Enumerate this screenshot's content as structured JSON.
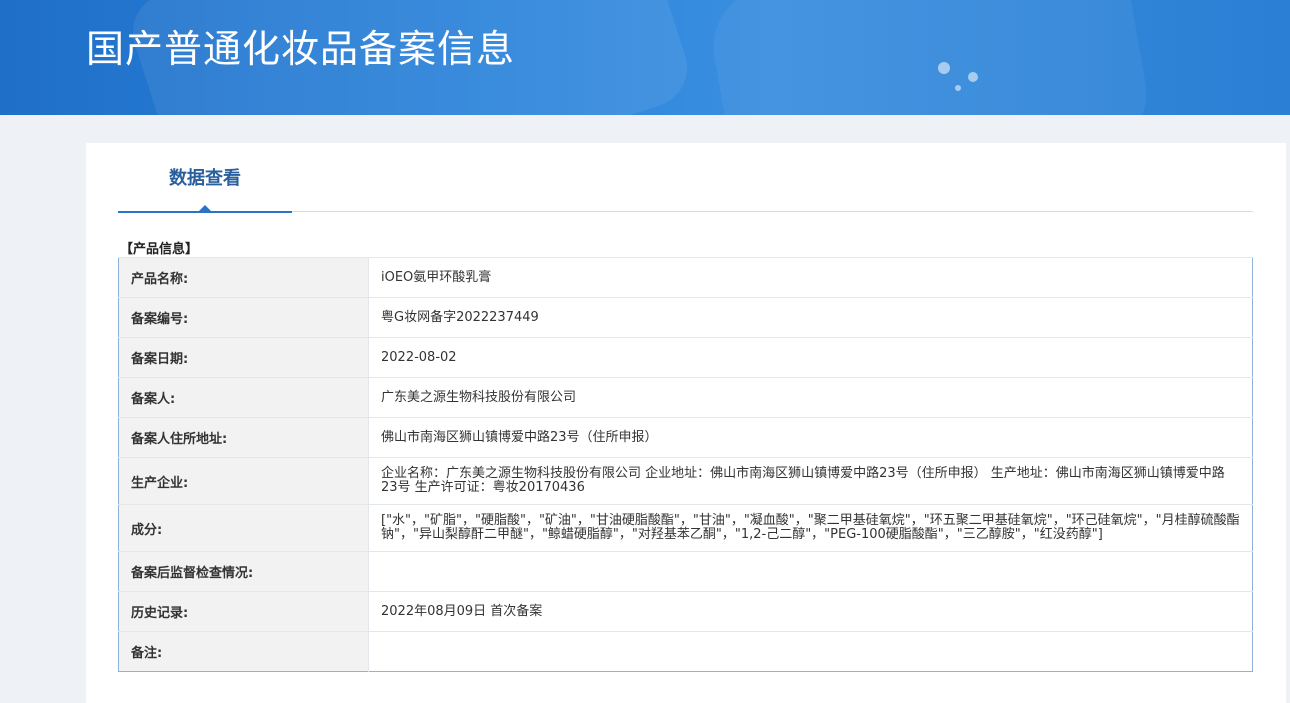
{
  "banner": {
    "title": "国产普通化妆品备案信息"
  },
  "tabs": [
    {
      "label": "数据查看"
    }
  ],
  "section": {
    "title": "【产品信息】"
  },
  "rows": [
    {
      "label": "产品名称:",
      "value": "iOEO氨甲环酸乳膏"
    },
    {
      "label": "备案编号:",
      "value": "粤G妆网备字2022237449"
    },
    {
      "label": "备案日期:",
      "value": "2022-08-02"
    },
    {
      "label": "备案人:",
      "value": "广东美之源生物科技股份有限公司"
    },
    {
      "label": "备案人住所地址:",
      "value": "佛山市南海区狮山镇博爱中路23号（住所申报）"
    },
    {
      "label": "生产企业:",
      "value": "企业名称：广东美之源生物科技股份有限公司 企业地址：佛山市南海区狮山镇博爱中路23号（住所申报） 生产地址：佛山市南海区狮山镇博爱中路23号 生产许可证：粤妆20170436"
    },
    {
      "label": "成分:",
      "value": "[\"水\"，\"矿脂\"，\"硬脂酸\"，\"矿油\"，\"甘油硬脂酸酯\"，\"甘油\"，\"凝血酸\"，\"聚二甲基硅氧烷\"，\"环五聚二甲基硅氧烷\"，\"环己硅氧烷\"，\"月桂醇硫酸酯钠\"，\"异山梨醇酐二甲醚\"，\"鲸蜡硬脂醇\"，\"对羟基苯乙酮\"，\"1,2-己二醇\"，\"PEG-100硬脂酸酯\"，\"三乙醇胺\"，\"红没药醇\"]"
    },
    {
      "label": "备案后监督检查情况:",
      "value": ""
    },
    {
      "label": "历史记录:",
      "value": "2022年08月09日 首次备案"
    },
    {
      "label": "备注:",
      "value": ""
    }
  ]
}
